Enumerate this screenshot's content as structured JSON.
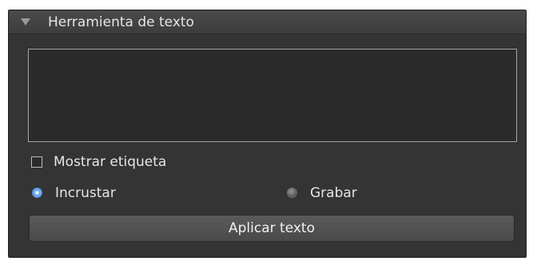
{
  "panel": {
    "title": "Herramienta de texto",
    "expanded": true,
    "collapse_icon": "triangle-down-icon"
  },
  "text_input": {
    "value": ""
  },
  "show_label": {
    "label": "Mostrar etiqueta",
    "checked": false
  },
  "mode": {
    "options": [
      {
        "label": "Incrustar",
        "selected": true
      },
      {
        "label": "Grabar",
        "selected": false
      }
    ]
  },
  "apply_button": {
    "label": "Aplicar texto"
  },
  "colors": {
    "panel_bg": "#343434",
    "header_bg": "#444444",
    "text": "#e6e6e6",
    "accent": "#6ea9f0"
  }
}
